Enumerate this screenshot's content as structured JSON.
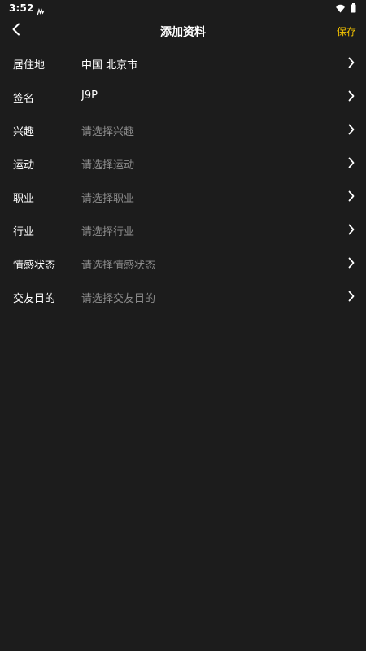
{
  "status_bar": {
    "time": "3:52",
    "notification_icon": "notification-icon",
    "wifi_icon": "wifi-icon",
    "battery_icon": "battery-icon"
  },
  "header": {
    "title": "添加资料",
    "back_icon": "back-arrow-icon",
    "save_label": "保存"
  },
  "colors": {
    "background": "#1c1c1c",
    "accent": "#f5c400",
    "label": "#ffffff",
    "placeholder": "#8c8c8c"
  },
  "rows": [
    {
      "label": "居住地",
      "value": "中国 北京市",
      "filled": true
    },
    {
      "label": "签名",
      "value": "J9P",
      "filled": true
    },
    {
      "label": "兴趣",
      "value": "请选择兴趣",
      "filled": false
    },
    {
      "label": "运动",
      "value": "请选择运动",
      "filled": false
    },
    {
      "label": "职业",
      "value": "请选择职业",
      "filled": false
    },
    {
      "label": "行业",
      "value": "请选择行业",
      "filled": false
    },
    {
      "label": "情感状态",
      "value": "请选择情感状态",
      "filled": false
    },
    {
      "label": "交友目的",
      "value": "请选择交友目的",
      "filled": false
    }
  ]
}
